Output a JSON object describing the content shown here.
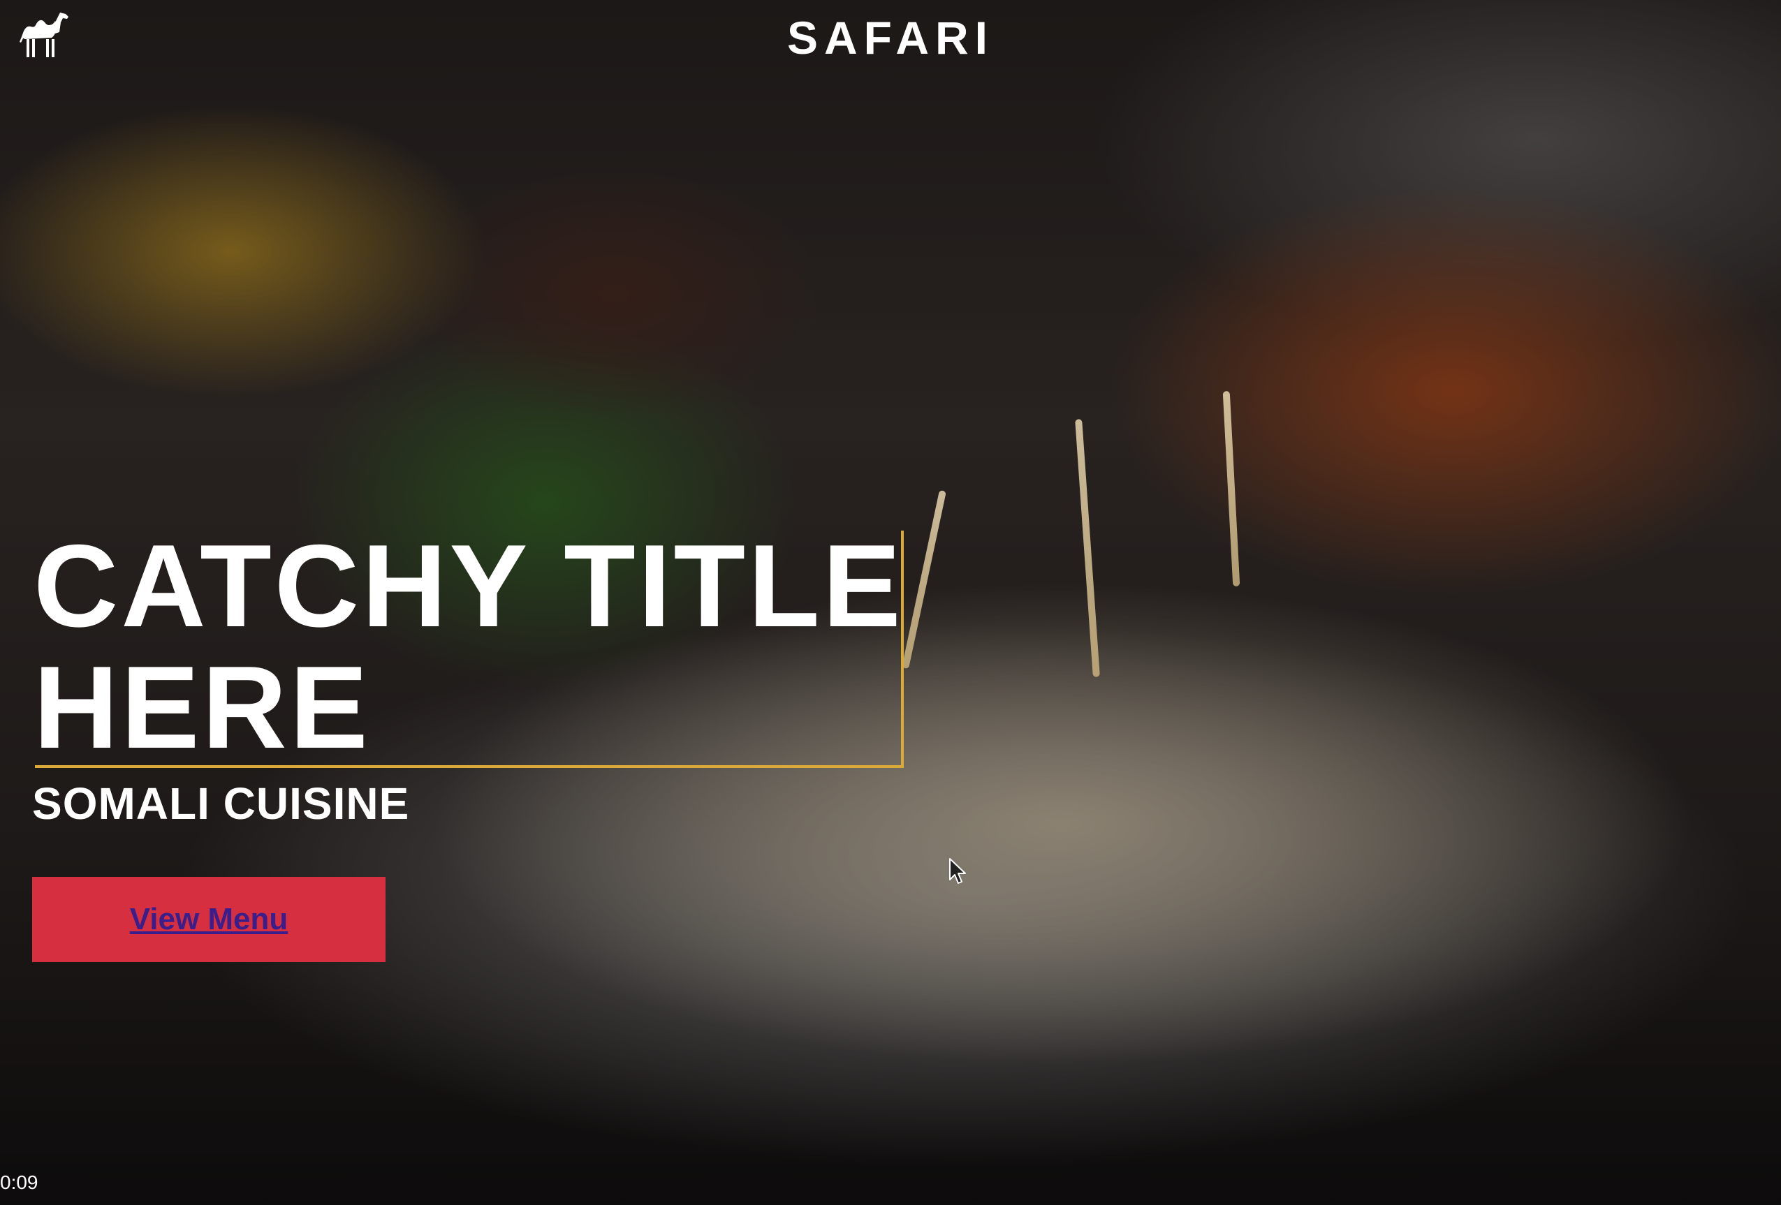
{
  "header": {
    "brand": "SAFARI",
    "logo_icon": "camel-icon"
  },
  "hero": {
    "title": "CATCHY TITLE HERE",
    "subtitle": "SOMALI CUISINE",
    "cta_label": "View Menu"
  },
  "video": {
    "timestamp": "0:09"
  },
  "colors": {
    "accent_frame": "#d9a93a",
    "cta_background": "#d62f3f",
    "cta_text": "#3a1f8c",
    "text": "#ffffff"
  }
}
